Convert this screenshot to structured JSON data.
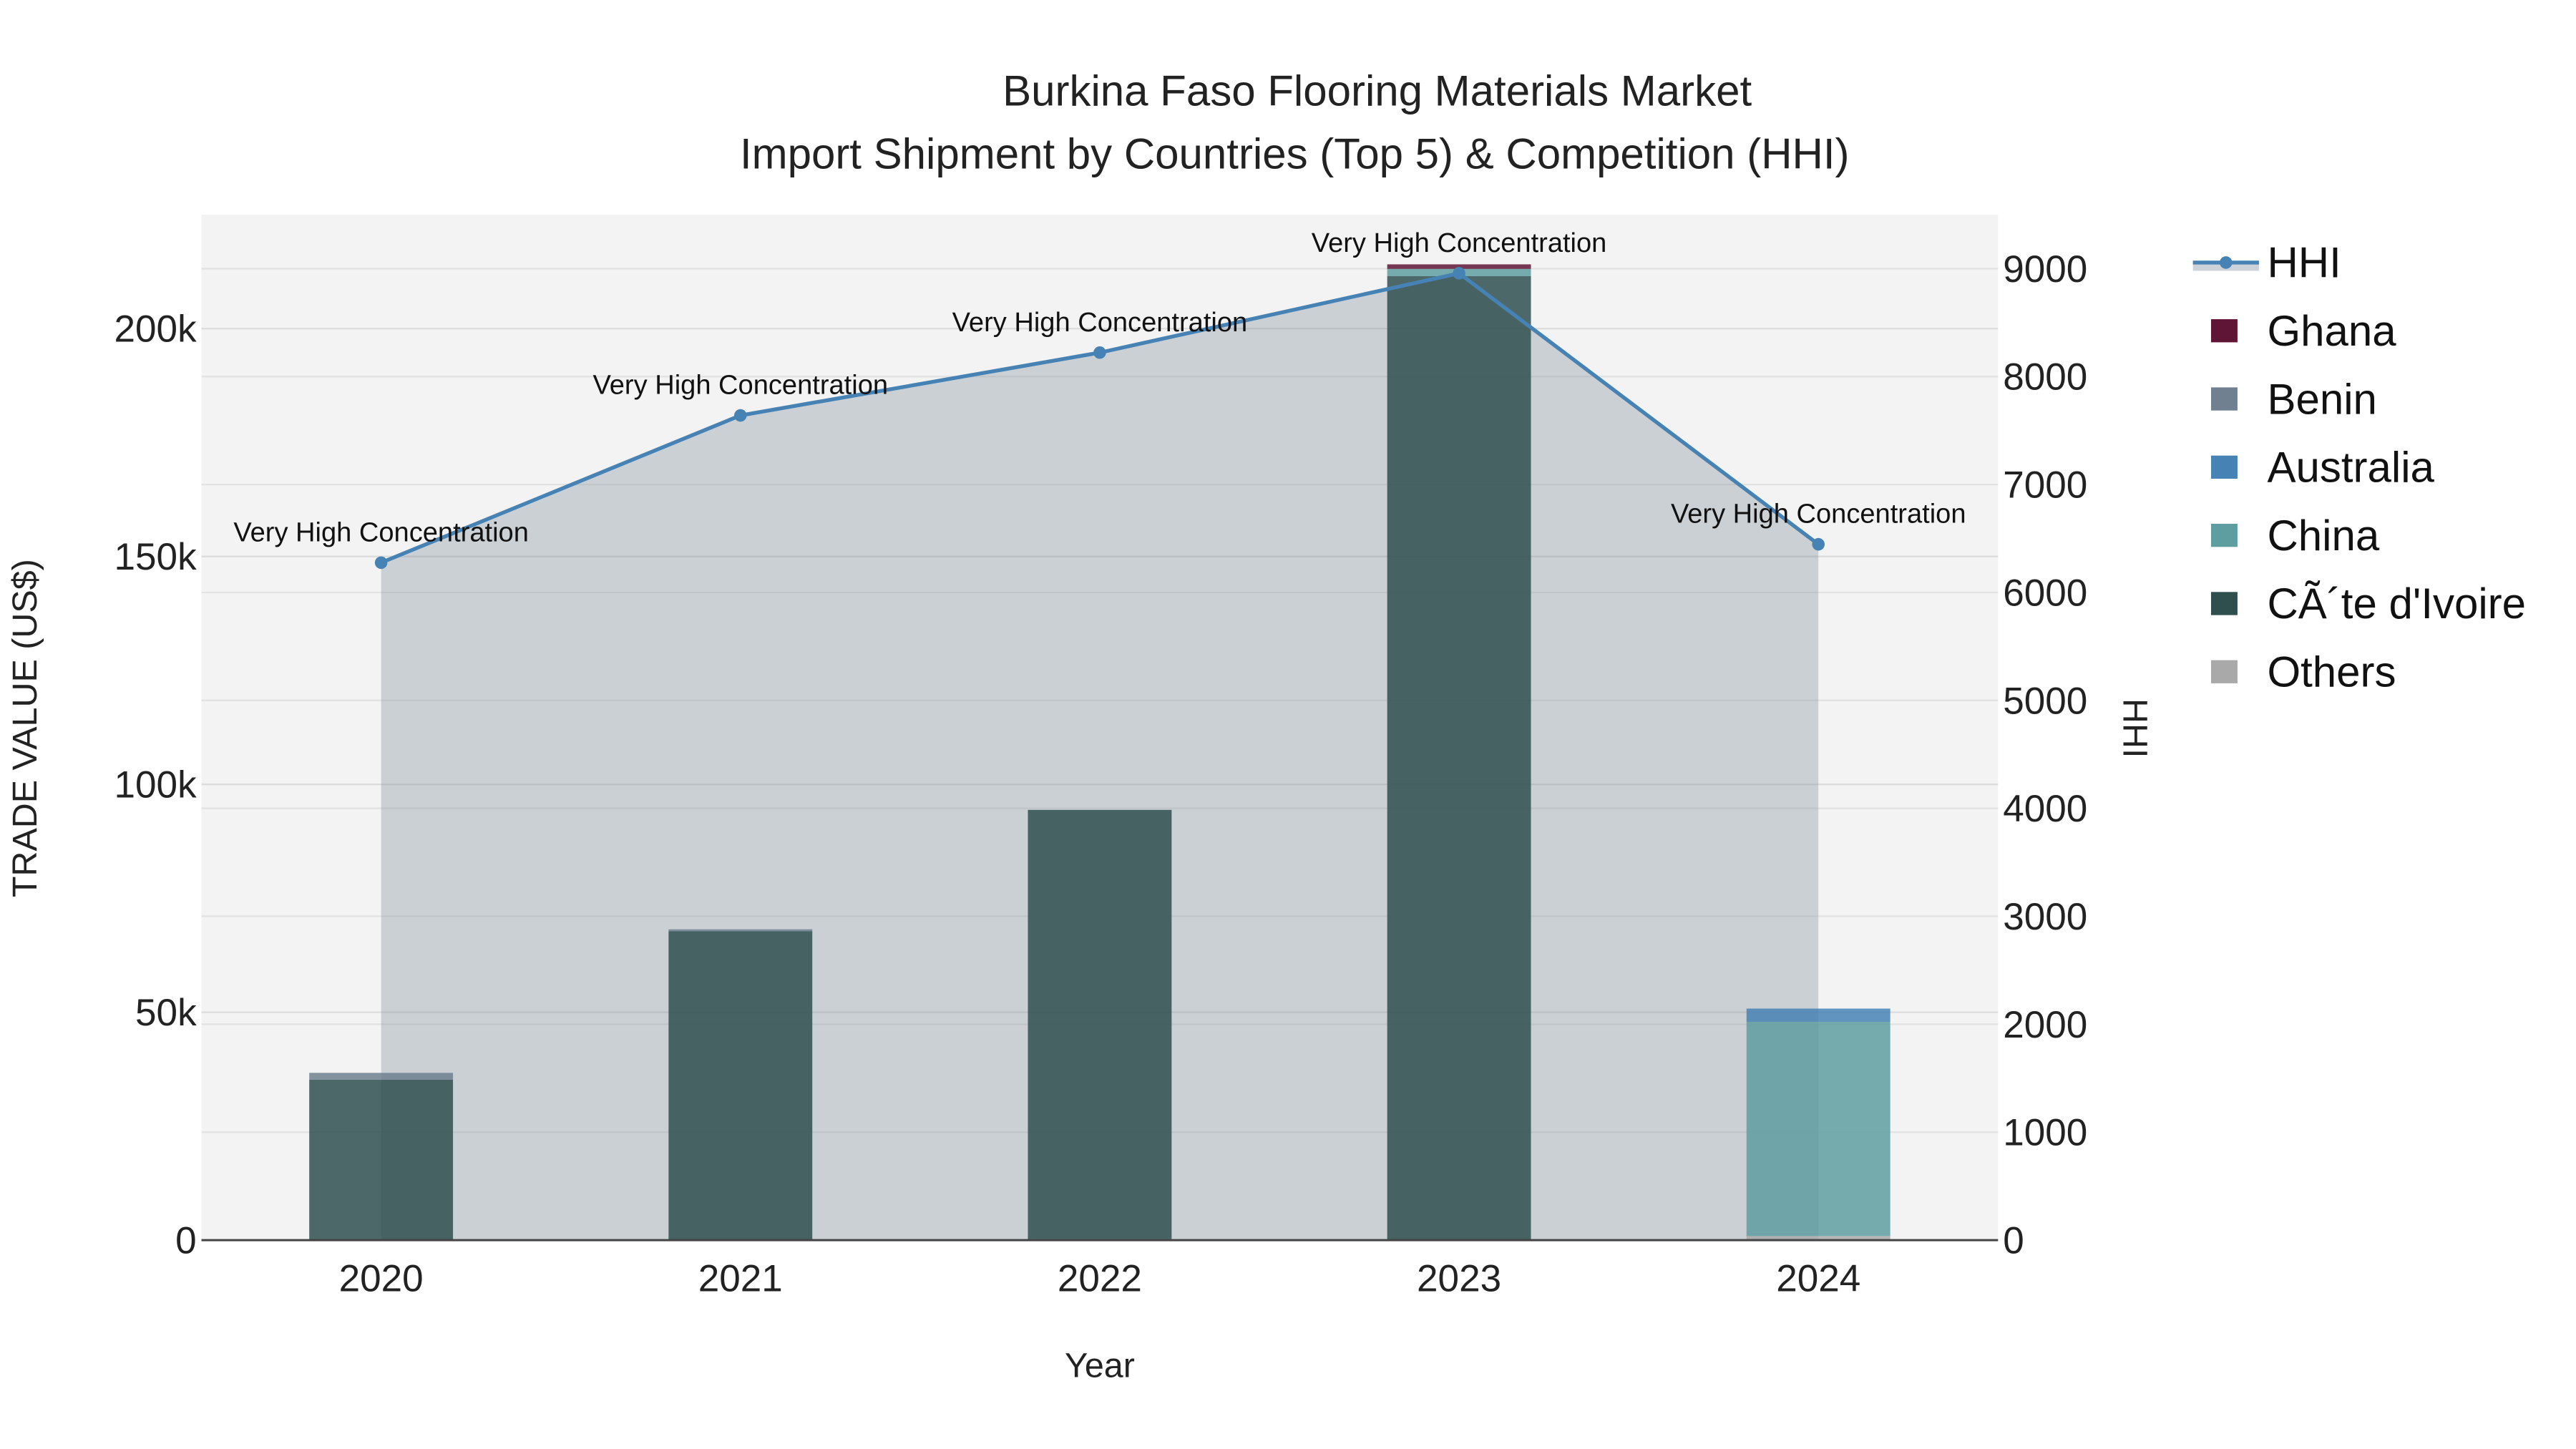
{
  "chart_data": {
    "type": "bar",
    "title": "Burkina Faso Flooring Materials Market",
    "subtitle": "Import Shipment by Countries (Top 5) & Competition (HHI)",
    "xlabel": "Year",
    "ylabel": "TRADE VALUE (US$)",
    "y2label": "HHI",
    "categories": [
      "2020",
      "2021",
      "2022",
      "2023",
      "2024"
    ],
    "ylim": [
      0,
      225000
    ],
    "y2lim": [
      0,
      9500
    ],
    "yticks": [
      0,
      50000,
      100000,
      150000,
      200000
    ],
    "ytick_labels": [
      "0",
      "50k",
      "100k",
      "150k",
      "200k"
    ],
    "y2ticks": [
      0,
      1000,
      2000,
      3000,
      4000,
      5000,
      6000,
      7000,
      8000,
      9000
    ],
    "y2tick_labels": [
      "0",
      "1000",
      "2000",
      "3000",
      "4000",
      "5000",
      "6000",
      "7000",
      "8000",
      "9000"
    ],
    "barmode": "stack",
    "grid": true,
    "legend_position": "right",
    "series": [
      {
        "name": "Others",
        "color": "#a9a9a9",
        "values": [
          0,
          0,
          200,
          0,
          900
        ]
      },
      {
        "name": "CÃ´te d'Ivoire",
        "color": "#2f4f4f",
        "values": [
          35200,
          67800,
          94200,
          211500,
          0
        ]
      },
      {
        "name": "China",
        "color": "#5f9ea0",
        "values": [
          0,
          0,
          0,
          1600,
          47000
        ]
      },
      {
        "name": "Australia",
        "color": "#4682b4",
        "values": [
          0,
          0,
          0,
          0,
          2900
        ]
      },
      {
        "name": "Benin",
        "color": "#708090",
        "values": [
          1500,
          400,
          0,
          0,
          0
        ]
      },
      {
        "name": "Ghana",
        "color": "#5f1535",
        "values": [
          0,
          0,
          0,
          1000,
          0
        ]
      }
    ],
    "hhi": {
      "name": "HHI",
      "color": "#4682b4",
      "values": [
        6276,
        7640,
        8222,
        8957,
        6446
      ],
      "annotations": [
        "Very High Concentration",
        "Very High Concentration",
        "Very High Concentration",
        "Very High Concentration",
        "Very High Concentration"
      ]
    },
    "legend_order": [
      "HHI",
      "Ghana",
      "Benin",
      "Australia",
      "China",
      "CÃ´te d'Ivoire",
      "Others"
    ]
  }
}
